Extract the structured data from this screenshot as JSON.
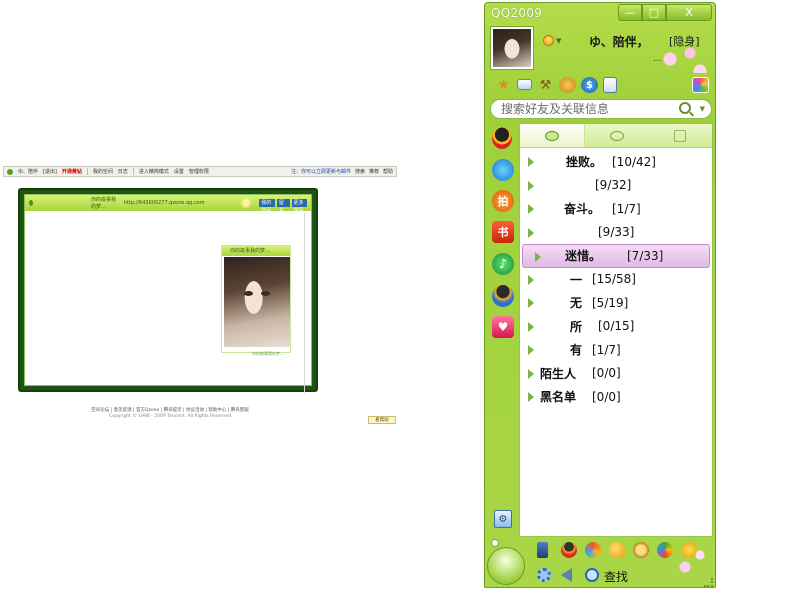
{
  "qzone": {
    "toolbar": {
      "user": "ゆ、陪伴",
      "exit": "[退出]",
      "upgrade": "开通黄钻",
      "my_space": "我的空间",
      "log": "日志",
      "mode": "进入精简模式",
      "settings": "设置",
      "manage": "管理权限",
      "feed_notice": "注：你可以立即更新与邮件",
      "search": "搜索",
      "recommend": "推荐",
      "help": "帮助"
    },
    "header": {
      "left": "你的故事我的梦...",
      "url": "http://643600277.qzone.qq.com",
      "btn1": "我的空间",
      "btn2": "留言板",
      "btn3": "更多空间"
    },
    "card": {
      "title": "你的故事我的梦...",
      "footer": "你的故事我的梦..."
    },
    "footer": {
      "links": "空间论坛 | 意见反馈 | 官方Qzone | 腾讯提示 | 抗议活动 | 帮助中心 | 腾讯客服",
      "copyright": "Copyright © 1998 - 2009 Tencent. All Rights Reserved"
    },
    "mini_button": "看帮助"
  },
  "qq": {
    "title": "QQ2009",
    "window_buttons": {
      "minimize": "—",
      "maximize": "□",
      "close": "X"
    },
    "profile": {
      "nickname": "ゆ、陪伴，",
      "status": "[隐身]",
      "signature": "..."
    },
    "search": {
      "placeholder": "搜索好友及关联信息"
    },
    "groups": [
      {
        "name": "挫败。",
        "count": "[10/42]",
        "selected": false
      },
      {
        "name": "",
        "count": "[9/32]",
        "selected": false
      },
      {
        "name": "奋斗。",
        "count": "[1/7]",
        "selected": false
      },
      {
        "name": "",
        "count": "[9/33]",
        "selected": false
      },
      {
        "name": "迷惜。",
        "count": "[7/33]",
        "selected": true
      },
      {
        "name": "一",
        "count": "[15/58]",
        "selected": false
      },
      {
        "name": "无",
        "count": "[5/19]",
        "selected": false
      },
      {
        "name": "所",
        "count": "[0/15]",
        "selected": false
      },
      {
        "name": "有",
        "count": "[1/7]",
        "selected": false
      },
      {
        "name": "陌生人",
        "count": "[0/0]",
        "selected": false
      },
      {
        "name": "黑名单",
        "count": "[0/0]",
        "selected": false
      }
    ],
    "bottom": {
      "find_label": "查找"
    },
    "colors": {
      "skin": "#a9d646",
      "selected_group": "#e2b9e6",
      "panel_border": "#95c64d"
    }
  }
}
